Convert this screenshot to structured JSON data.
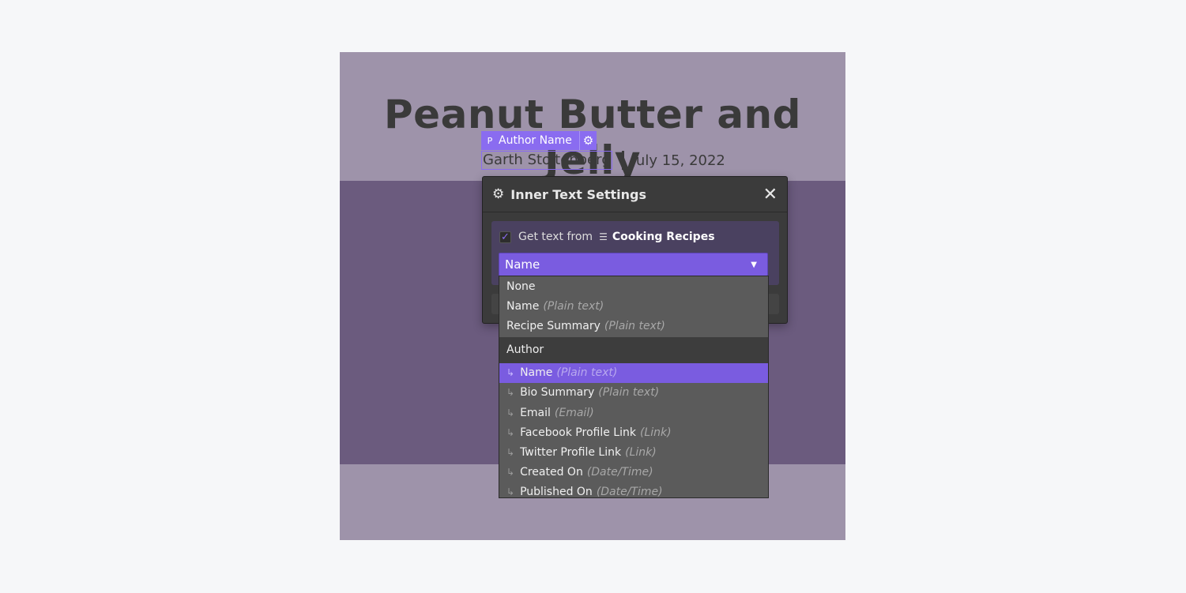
{
  "page": {
    "title": "Peanut Butter and Jelly",
    "author": "Garth Stoltenberg",
    "date": "July 15, 2022"
  },
  "element_tag": {
    "type": "P",
    "label": "Author Name",
    "settings_icon": "gear-icon"
  },
  "modal": {
    "title": "Inner Text Settings",
    "close_icon": "close-icon",
    "checkbox_checked": true,
    "get_text_label": "Get text from",
    "collection": "Cooking Recipes",
    "collection_icon": "database-icon",
    "selected_value": "Name"
  },
  "dropdown": {
    "options": [
      {
        "label": "None",
        "type": ""
      },
      {
        "label": "Name",
        "type": "(Plain text)"
      },
      {
        "label": "Recipe Summary",
        "type": "(Plain text)"
      }
    ],
    "group": "Author",
    "group_options": [
      {
        "label": "Name",
        "type": "(Plain text)",
        "selected": true
      },
      {
        "label": "Bio Summary",
        "type": "(Plain text)"
      },
      {
        "label": "Email",
        "type": "(Email)"
      },
      {
        "label": "Facebook Profile Link",
        "type": "(Link)"
      },
      {
        "label": "Twitter Profile Link",
        "type": "(Link)"
      },
      {
        "label": "Created On",
        "type": "(Date/Time)"
      },
      {
        "label": "Published On",
        "type": "(Date/Time)"
      }
    ]
  },
  "colors": {
    "accent": "#7a5ce0",
    "modal_bg": "#3b3b3b",
    "canvas": "#9e93aa"
  }
}
